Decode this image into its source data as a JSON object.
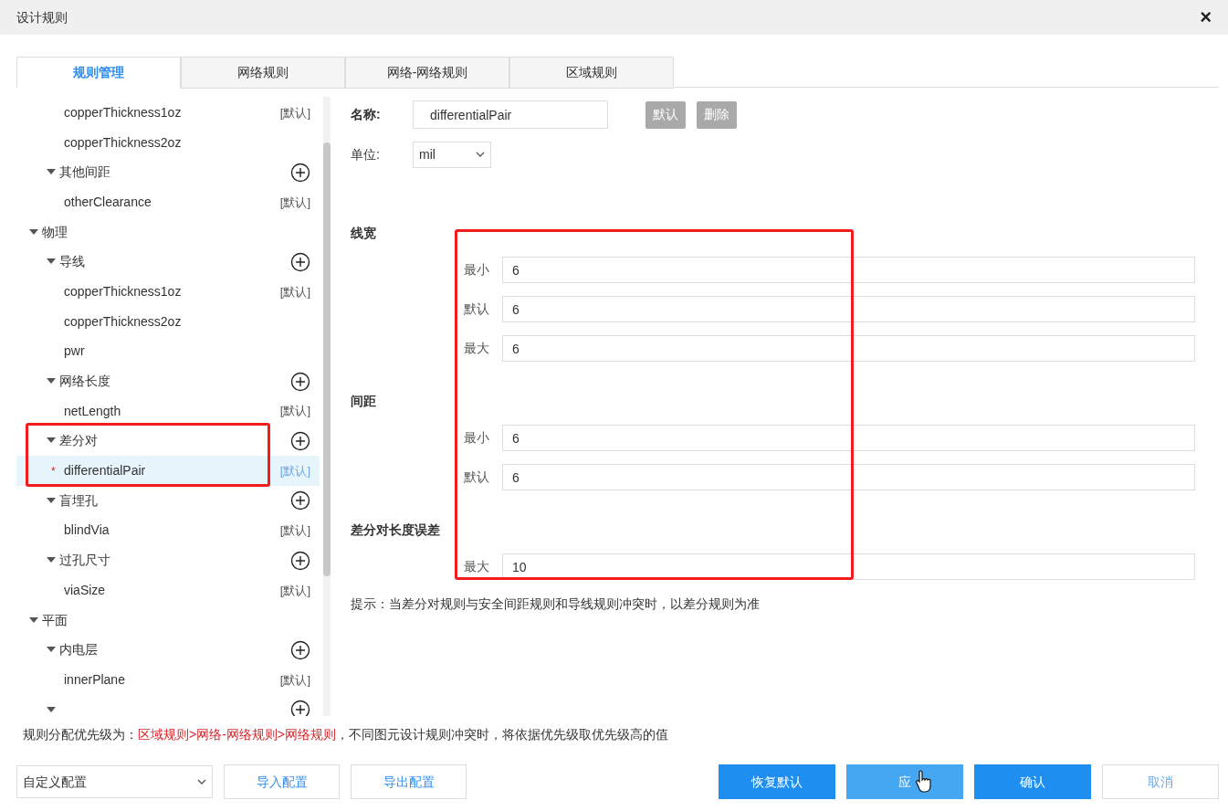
{
  "window": {
    "title": "设计规则",
    "close": "×"
  },
  "tabs": [
    {
      "label": "规则管理",
      "selected": true
    },
    {
      "label": "网络规则",
      "selected": false
    },
    {
      "label": "网络-网络规则",
      "selected": false
    },
    {
      "label": "区域规则",
      "selected": false
    }
  ],
  "tree": [
    {
      "children": [
        {
          "children": [
            {
              "label": "copperThickness1oz",
              "tag": "[默认]",
              "selected": false
            },
            {
              "label": "copperThickness2oz",
              "selected": false
            }
          ]
        },
        {
          "label": "其他间距",
          "expanded": true,
          "addable": true,
          "children": [
            {
              "label": "otherClearance",
              "tag": "[默认]",
              "selected": false
            }
          ]
        }
      ]
    },
    {
      "label": "物理",
      "expanded": true,
      "children": [
        {
          "label": "导线",
          "expanded": true,
          "addable": true,
          "children": [
            {
              "label": "copperThickness1oz",
              "tag": "[默认]",
              "selected": false
            },
            {
              "label": "copperThickness2oz",
              "selected": false
            },
            {
              "label": "pwr",
              "selected": false
            }
          ]
        },
        {
          "label": "网络长度",
          "expanded": true,
          "addable": true,
          "children": [
            {
              "label": "netLength",
              "tag": "[默认]",
              "selected": false
            }
          ]
        },
        {
          "label": "差分对",
          "expanded": true,
          "addable": true,
          "children": [
            {
              "label": "differentialPair",
              "tag": "[默认]",
              "selected": true,
              "marker": "*"
            }
          ]
        },
        {
          "label": "盲埋孔",
          "expanded": true,
          "addable": true,
          "children": [
            {
              "label": "blindVia",
              "tag": "[默认]",
              "selected": false
            }
          ]
        },
        {
          "label": "过孔尺寸",
          "expanded": true,
          "addable": true,
          "children": [
            {
              "label": "viaSize",
              "tag": "[默认]",
              "selected": false
            }
          ]
        }
      ]
    },
    {
      "label": "平面",
      "expanded": true,
      "children": [
        {
          "label": "内电层",
          "expanded": true,
          "addable": true,
          "children": [
            {
              "label": "innerPlane",
              "tag": "[默认]",
              "selected": false
            }
          ]
        },
        {
          "expanded": true,
          "addable": true
        }
      ]
    }
  ],
  "form": {
    "name_label": "名称:",
    "name_value": "differentialPair",
    "actions": [
      {
        "label": "默认",
        "disabled": true
      },
      {
        "label": "删除",
        "disabled": true
      }
    ],
    "unit_label": "单位:",
    "unit_value": "mil",
    "sections": [
      {
        "title": "线宽",
        "fields": [
          {
            "label": "最小",
            "value": "6"
          },
          {
            "label": "默认",
            "value": "6"
          },
          {
            "label": "最大",
            "value": "6"
          }
        ]
      },
      {
        "title": "间距",
        "fields": [
          {
            "label": "最小",
            "value": "6"
          },
          {
            "label": "默认",
            "value": "6"
          }
        ]
      },
      {
        "title": "差分对长度误差",
        "fields": [
          {
            "label": "最大",
            "value": "10"
          }
        ]
      }
    ],
    "hint": "提示：当差分对规则与安全间距规则和导线规则冲突时，以差分规则为准"
  },
  "priority_note": [
    {
      "text": "规则分配优先级为：",
      "emphasis": false
    },
    {
      "text": "区域规则>网络-网络规则>网络规则",
      "emphasis": true
    },
    {
      "text": "，不同图元设计规则冲突时，将依据优先级取优先级高的值",
      "emphasis": false
    }
  ],
  "footer": {
    "config_select": "自定义配置",
    "left_buttons": [
      "导入配置",
      "导出配置"
    ],
    "right_buttons": [
      {
        "label": "恢复默认",
        "kind": "primary"
      },
      {
        "label": "应",
        "kind": "hover"
      },
      {
        "label": "确认",
        "kind": "primary"
      },
      {
        "label": "取消",
        "kind": "outline"
      }
    ]
  }
}
